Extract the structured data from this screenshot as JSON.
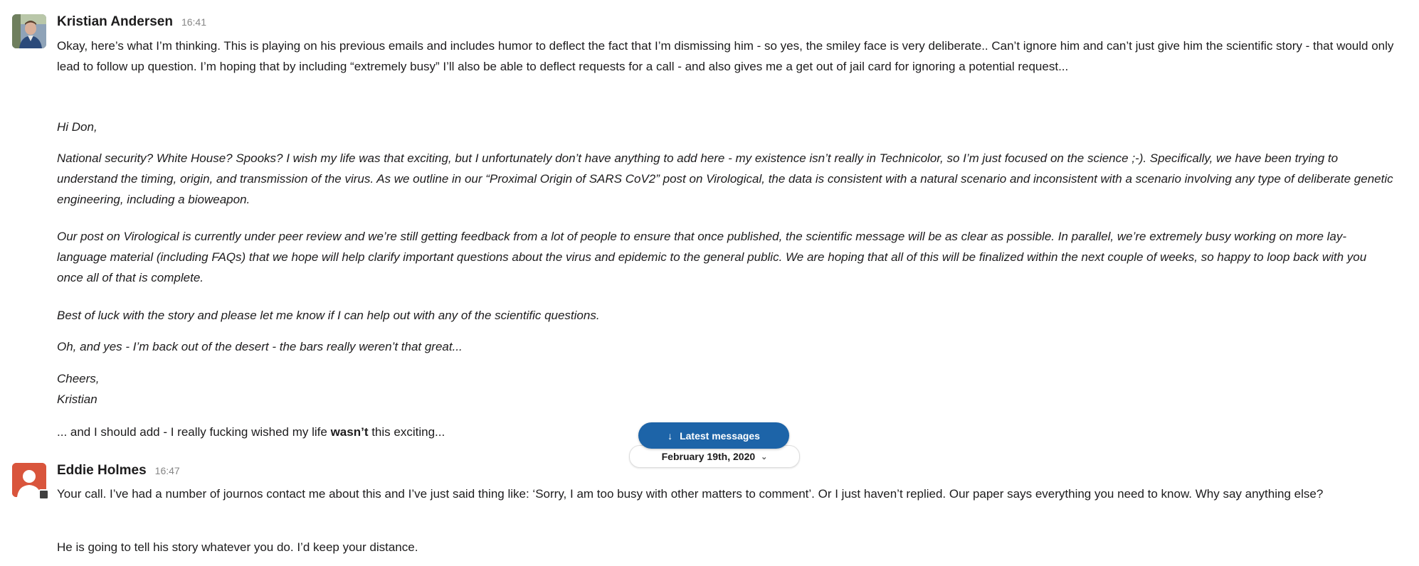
{
  "colors": {
    "latest_button_bg": "#1d64a8",
    "eddie_avatar": "#d9553c",
    "text": "#1d1c1d",
    "timestamp": "#868686"
  },
  "messages": [
    {
      "author": "Kristian Andersen",
      "time": "16:41",
      "avatar": "photo-avatar",
      "paragraphs": [
        "Okay, here’s what I’m thinking. This is playing on his previous emails and includes humor to deflect the fact that I’m dismissing him - so yes, the smiley face is very deliberate.. Can’t ignore him and can’t just give him the scientific story - that would only lead to follow up question. I’m hoping that by including “extremely busy” I’ll also be able to deflect requests for a call - and also gives me a get out of jail card for ignoring a potential request...",
        "Hi Don,",
        "National security? White House? Spooks? I wish my life was that exciting, but I unfortunately don’t have anything to add here - my existence isn’t really in Technicolor, so I’m just focused on the science ;-). Specifically, we have been trying to understand the timing, origin, and transmission of the virus. As we outline in our “Proximal Origin of SARS CoV2” post on Virological, the data is consistent with a natural scenario and inconsistent with a scenario involving any type of deliberate genetic engineering, including a bioweapon.",
        "Our post on Virological is currently under peer review and we’re still getting feedback from a lot of people to ensure that once published, the scientific message will be as clear as possible. In parallel, we’re extremely busy working on more lay-language material (including FAQs) that we hope will help clarify important questions about the virus and epidemic to the general public. We are hoping that all of this will be finalized within the next couple of weeks, so happy to loop back with you once all of that is complete.",
        "Best of luck with the story and please let me know if I can help out with any of the scientific questions.",
        "Oh, and yes - I’m back out of the desert - the bars really weren’t that great...",
        "Cheers,",
        "Kristian"
      ],
      "followup_prefix": "... and I should add - I really fucking wished my life ",
      "followup_bold": "wasn’t",
      "followup_suffix": " this exciting..."
    },
    {
      "author": "Eddie Holmes",
      "time": "16:47",
      "avatar": "default-avatar",
      "paragraphs": [
        "Your call. I’ve had a number of journos contact me about this and I’ve just said thing like: ‘Sorry, I am too busy with other matters to comment’. Or I just haven’t replied. Our paper says everything you need to know. Why say anything else?",
        "He is going to tell his story whatever you do. I’d keep your distance."
      ]
    }
  ],
  "latest_messages": {
    "label": "Latest messages",
    "icon": "arrow-down-icon"
  },
  "date_divider": {
    "label": "February 19th, 2020",
    "icon": "chevron-down-icon"
  }
}
